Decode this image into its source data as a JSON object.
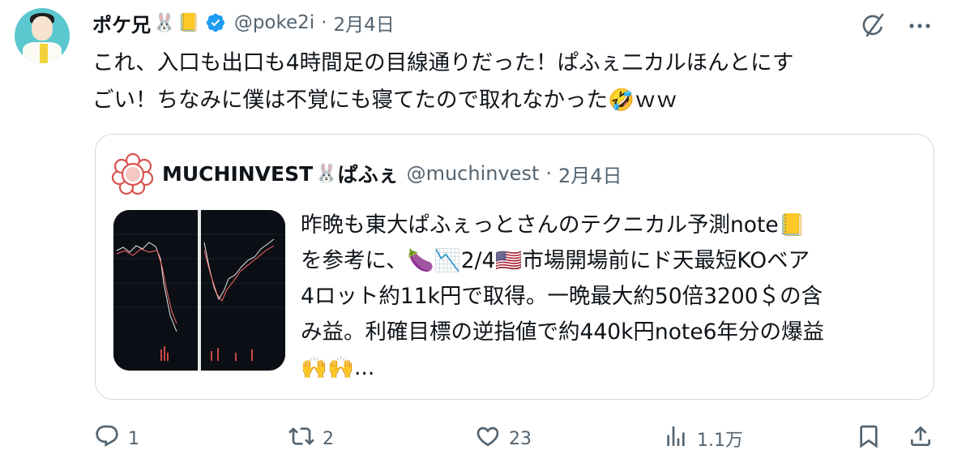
{
  "author": {
    "name": "ポケ兄",
    "name_emojis": [
      "🐰",
      "📒"
    ],
    "handle": "@poke2i",
    "separator": "·",
    "date": "2月4日"
  },
  "tweet": {
    "lines": [
      "これ、入口も出口も4時間足の目線通りだった！ぱふぇ二カルほんとにす",
      "ごい！ちなみに僕は不覚にも寝てたので取れなかった🤣ｗｗ"
    ]
  },
  "quoted": {
    "name": "MUCHINVEST",
    "name_emoji": "🐰",
    "name_suffix": "ぱふぇ",
    "handle": "@muchinvest",
    "separator": "·",
    "date": "2月4日",
    "lines": [
      "昨晩も東大ぱふぇっとさんのテクニカル予測note📒",
      "を参考に、🍆📉2/4🇺🇸市場開場前にド天最短KOベア",
      "4ロット約11k円で取得。一晩最大約50倍3200＄の含",
      "み益。利確目標の逆指値で約440k円note6年分の爆益",
      "🙌🙌..."
    ]
  },
  "actions": {
    "reply_count": "1",
    "retweet_count": "2",
    "like_count": "23",
    "views_count": "1.1万"
  },
  "icons": {
    "verified": "verified-badge-icon",
    "grok": "grok-icon",
    "more": "more-icon",
    "reply": "reply-icon",
    "retweet": "retweet-icon",
    "like": "heart-icon",
    "views": "views-icon",
    "bookmark": "bookmark-icon",
    "share": "share-icon"
  },
  "colors": {
    "verified": "#1d9bf0",
    "secondary_text": "#536471",
    "border": "#cfd9de"
  }
}
